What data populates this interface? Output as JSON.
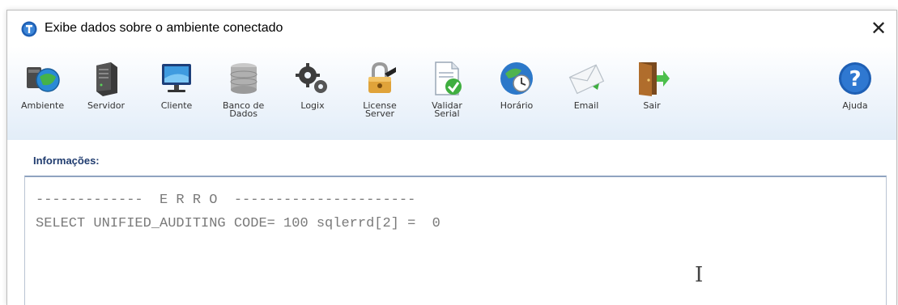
{
  "window": {
    "title": "Exibe dados sobre o ambiente conectado",
    "close_glyph": "✕"
  },
  "toolbar": {
    "items": [
      {
        "label": "Ambiente",
        "icon": "environment-icon"
      },
      {
        "label": "Servidor",
        "icon": "server-icon"
      },
      {
        "label": "Cliente",
        "icon": "client-monitor-icon"
      },
      {
        "label": "Banco de\nDados",
        "icon": "database-icon"
      },
      {
        "label": "Logix",
        "icon": "gears-icon"
      },
      {
        "label": "License\nServer",
        "icon": "license-server-icon"
      },
      {
        "label": "Validar\nSerial",
        "icon": "validate-serial-icon"
      },
      {
        "label": "Horário",
        "icon": "globe-clock-icon"
      },
      {
        "label": "Email",
        "icon": "email-icon"
      },
      {
        "label": "Sair",
        "icon": "exit-door-icon"
      }
    ],
    "help": {
      "label": "Ajuda",
      "icon": "help-icon"
    }
  },
  "info": {
    "label": "Informações:",
    "lines": [
      "-------------  E R R O  ----------------------",
      "SELECT UNIFIED_AUDITING CODE= 100 sqlerrd[2] =  0"
    ]
  },
  "colors": {
    "accent": "#1f3b6e",
    "help_blue": "#1e5fb4",
    "text_gray": "#7a7a7a"
  }
}
